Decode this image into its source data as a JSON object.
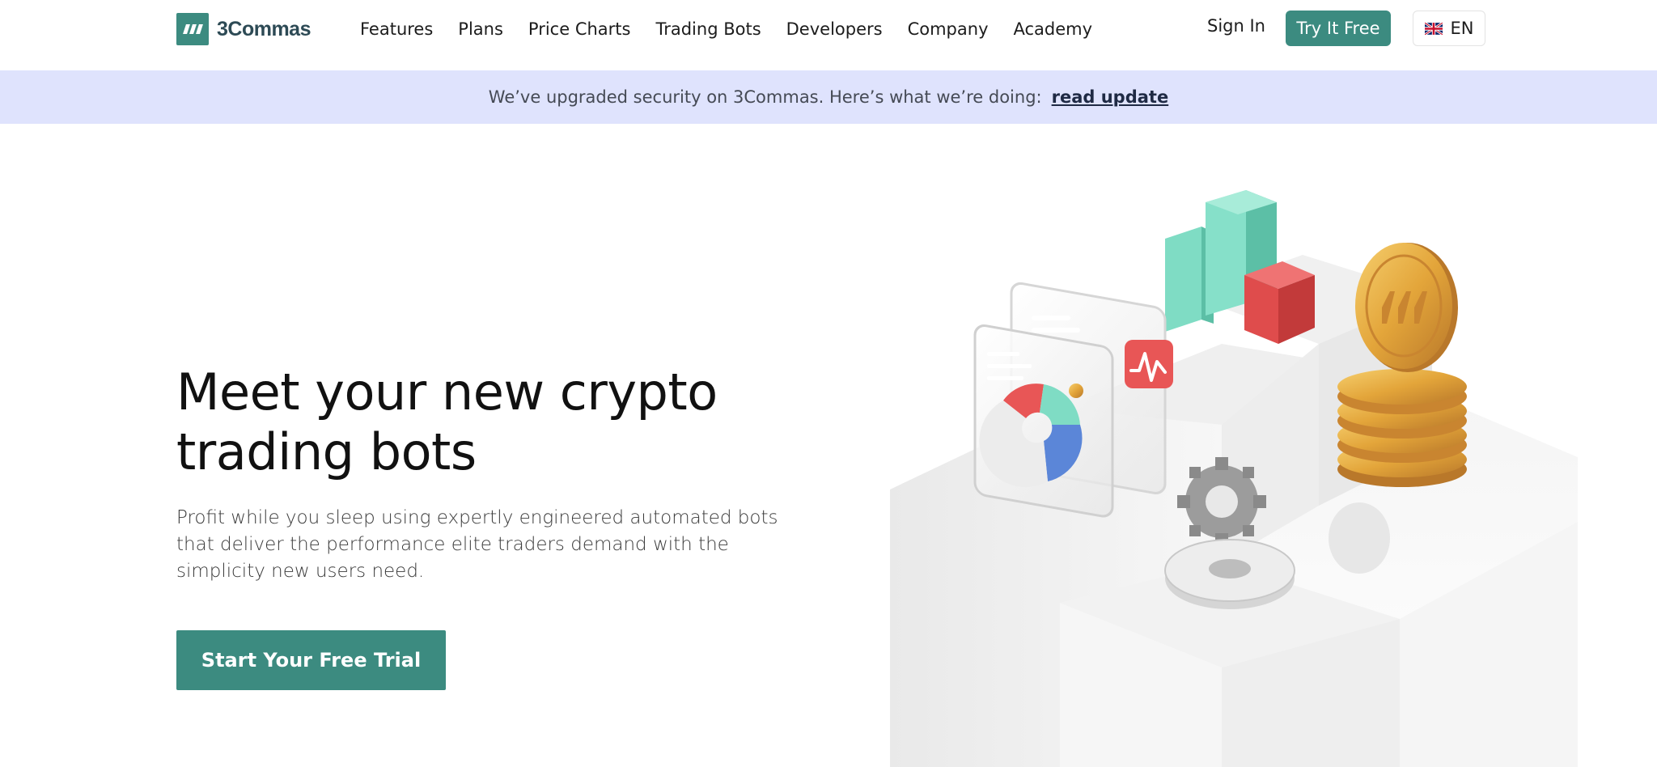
{
  "brand": {
    "name": "3Commas",
    "logo_icon": "3commas-logo-icon"
  },
  "nav": {
    "items": [
      {
        "label": "Features"
      },
      {
        "label": "Plans"
      },
      {
        "label": "Price Charts"
      },
      {
        "label": "Trading Bots"
      },
      {
        "label": "Developers"
      },
      {
        "label": "Company"
      },
      {
        "label": "Academy"
      }
    ]
  },
  "header": {
    "signin_label": "Sign In",
    "try_label": "Try It Free",
    "language": "EN",
    "language_icon": "uk-flag-icon"
  },
  "banner": {
    "text": "We’ve upgraded security on 3Commas. Here’s what we’re doing:",
    "link": "read update"
  },
  "hero": {
    "title_line1": "Meet your new crypto",
    "title_line2": "trading bots",
    "subtitle": "Profit while you sleep using expertly engineered automated bots that deliver the performance elite traders demand with the simplicity new users need.",
    "cta_label": "Start Your Free Trial"
  },
  "colors": {
    "brand_green": "#3c8b80",
    "banner_bg": "#dfe3fd",
    "bar_mint": "#76d6bf",
    "bar_red": "#df4c4c",
    "coin_gold": "#e6a53c"
  }
}
